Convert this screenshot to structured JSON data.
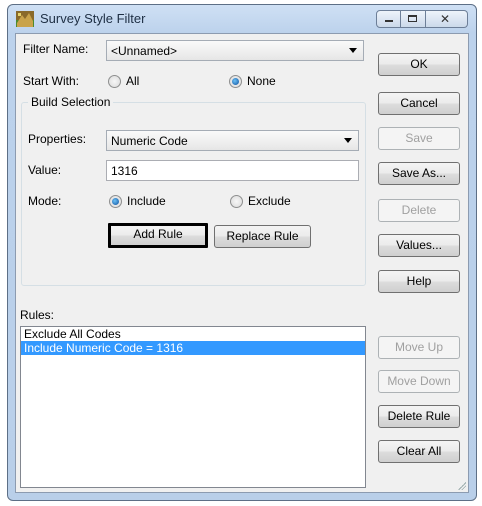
{
  "window": {
    "title": "Survey Style Filter",
    "icon": "survey-style-app-icon",
    "controls": [
      "minimize-icon",
      "maximize-icon",
      "close-icon"
    ]
  },
  "filter_name": {
    "label": "Filter Name:",
    "value": "<Unnamed>"
  },
  "start_with": {
    "label": "Start With:",
    "options": [
      "All",
      "None"
    ],
    "selected": "None"
  },
  "build_selection": {
    "legend": "Build Selection",
    "properties_label": "Properties:",
    "properties_value": "Numeric Code",
    "value_label": "Value:",
    "value": "1316",
    "mode_label": "Mode:",
    "mode_options": [
      "Include",
      "Exclude"
    ],
    "mode_selected": "Include",
    "add_rule": "Add Rule",
    "replace_rule": "Replace Rule"
  },
  "rules": {
    "label": "Rules:",
    "items": [
      "Exclude All Codes",
      "Include Numeric Code = 1316"
    ],
    "selected_index": 1
  },
  "buttons": {
    "ok": "OK",
    "cancel": "Cancel",
    "save": "Save",
    "save_as": "Save As...",
    "delete": "Delete",
    "values": "Values...",
    "help": "Help",
    "move_up": "Move Up",
    "move_down": "Move Down",
    "delete_rule": "Delete Rule",
    "clear_all": "Clear All"
  },
  "colors": {
    "selection": "#3399ff",
    "title_bar": "#bcd2ec",
    "disabled_text": "#a0a0a0"
  }
}
